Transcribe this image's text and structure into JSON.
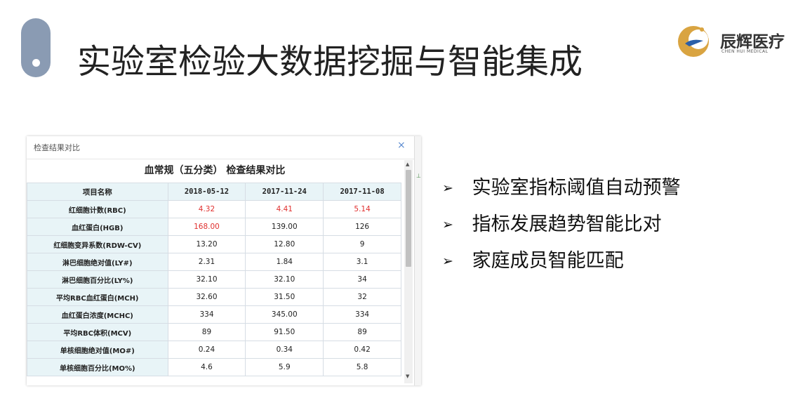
{
  "slide": {
    "title": "实验室检验大数据挖掘与智能集成",
    "accent_color": "#8a9bb3"
  },
  "logo": {
    "name_cn": "辰辉医疗",
    "name_en": "CHEN HUI MEDICAL",
    "colors": {
      "gold": "#d9a441",
      "blue": "#2b5fa8"
    }
  },
  "dialog": {
    "title": "检查结果对比",
    "close_symbol": "×",
    "table_caption": "血常规（五分类） 检查结果对比",
    "columns": [
      "项目名称",
      "2018-05-12",
      "2017-11-24",
      "2017-11-08"
    ],
    "rows": [
      {
        "name": "红细胞计数(RBC)",
        "values": [
          "4.32",
          "4.41",
          "5.14"
        ],
        "flags": [
          true,
          true,
          true
        ]
      },
      {
        "name": "血红蛋白(HGB)",
        "values": [
          "168.00",
          "139.00",
          "126"
        ],
        "flags": [
          true,
          false,
          false
        ]
      },
      {
        "name": "红细胞变异系数(RDW-CV)",
        "values": [
          "13.20",
          "12.80",
          "9"
        ],
        "flags": [
          false,
          false,
          false
        ]
      },
      {
        "name": "淋巴细胞绝对值(LY#)",
        "values": [
          "2.31",
          "1.84",
          "3.1"
        ],
        "flags": [
          false,
          false,
          false
        ]
      },
      {
        "name": "淋巴细胞百分比(LY%)",
        "values": [
          "32.10",
          "32.10",
          "34"
        ],
        "flags": [
          false,
          false,
          false
        ]
      },
      {
        "name": "平均RBC血红蛋白(MCH)",
        "values": [
          "32.60",
          "31.50",
          "32"
        ],
        "flags": [
          false,
          false,
          false
        ]
      },
      {
        "name": "血红蛋白浓度(MCHC)",
        "values": [
          "334",
          "345.00",
          "334"
        ],
        "flags": [
          false,
          false,
          false
        ]
      },
      {
        "name": "平均RBC体积(MCV)",
        "values": [
          "89",
          "91.50",
          "89"
        ],
        "flags": [
          false,
          false,
          false
        ]
      },
      {
        "name": "单核细胞绝对值(MO#)",
        "values": [
          "0.24",
          "0.34",
          "0.42"
        ],
        "flags": [
          false,
          false,
          false
        ]
      },
      {
        "name": "单核细胞百分比(MO%)",
        "values": [
          "4.6",
          "5.9",
          "5.8"
        ],
        "flags": [
          false,
          false,
          false
        ]
      }
    ],
    "highlight_color": "#e0302f"
  },
  "bullets": {
    "arrow": "➢",
    "items": [
      "实验室指标阈值自动预警",
      "指标发展趋势智能比对",
      "家庭成员智能匹配"
    ]
  }
}
